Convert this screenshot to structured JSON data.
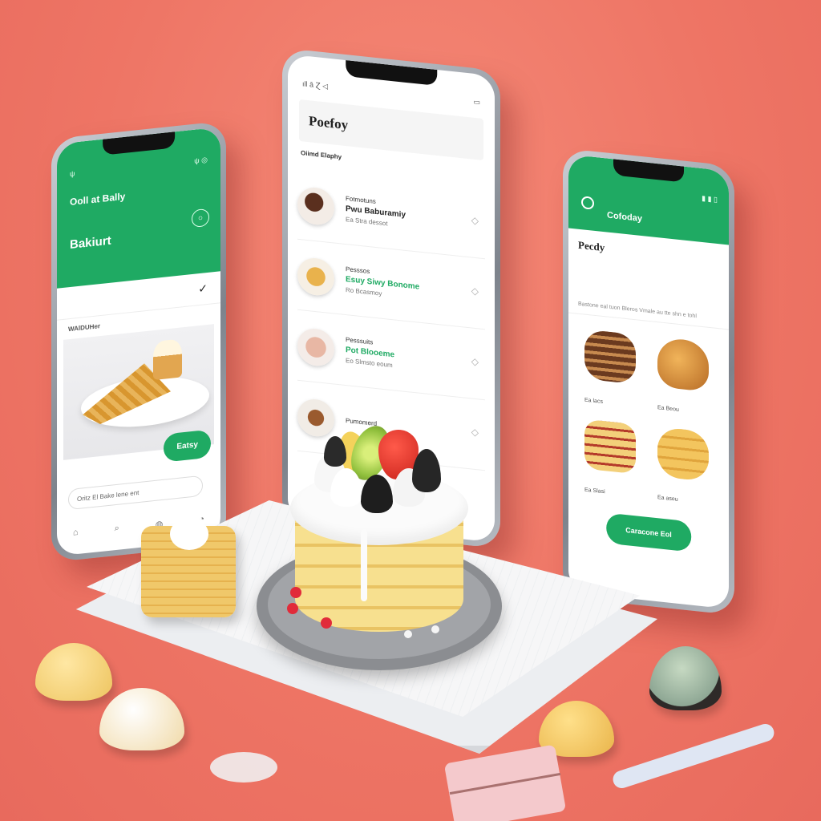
{
  "colors": {
    "background": "#ee7565",
    "accent_green": "#1faa63",
    "phone_frame": "#9aa0a8"
  },
  "left_phone": {
    "status_left": "ψ",
    "status_right": "ψ ◎",
    "header_title": "Ooll at Bally",
    "brand": "Bakiurt",
    "brand_sub": "",
    "section_label": "WAlDUHer",
    "order_button": "Eatsy",
    "search_text": "Oritz El Bake lene ent",
    "icons": [
      "home-icon",
      "search-icon",
      "location-icon",
      "profile-icon"
    ]
  },
  "center_phone": {
    "status_left": "ıll ȃ Ɀ ◁",
    "status_right": "▭",
    "title": "Poefoy",
    "subtitle": "Oiimd Elaphy",
    "items": [
      {
        "tag": "Fotmotuns",
        "name": "Pwu Baburamiy",
        "price": "Ea Stra dessot"
      },
      {
        "tag": "Pesssos",
        "name": "Esuy Siwy Bonome",
        "price": "Ro Bcasmoy"
      },
      {
        "tag": "Pesssuits",
        "name": "Pot Blooeme",
        "price": "Eo Slmsto eoum"
      },
      {
        "tag": "Pumomerd",
        "name": "",
        "price": ""
      }
    ]
  },
  "right_phone": {
    "status_right": "▮ ▮ ▯",
    "brand": "Cofoday",
    "title": "Pecdy",
    "description": "Bastone eal tuon Bleros Vmale au tte shn e tohl",
    "products": [
      {
        "caption": "Ea lacs"
      },
      {
        "caption": "Ea Beou"
      },
      {
        "caption": "Ea Slasi"
      },
      {
        "caption": "Ea aseu"
      }
    ],
    "cart_button": "Caracone Eol"
  }
}
